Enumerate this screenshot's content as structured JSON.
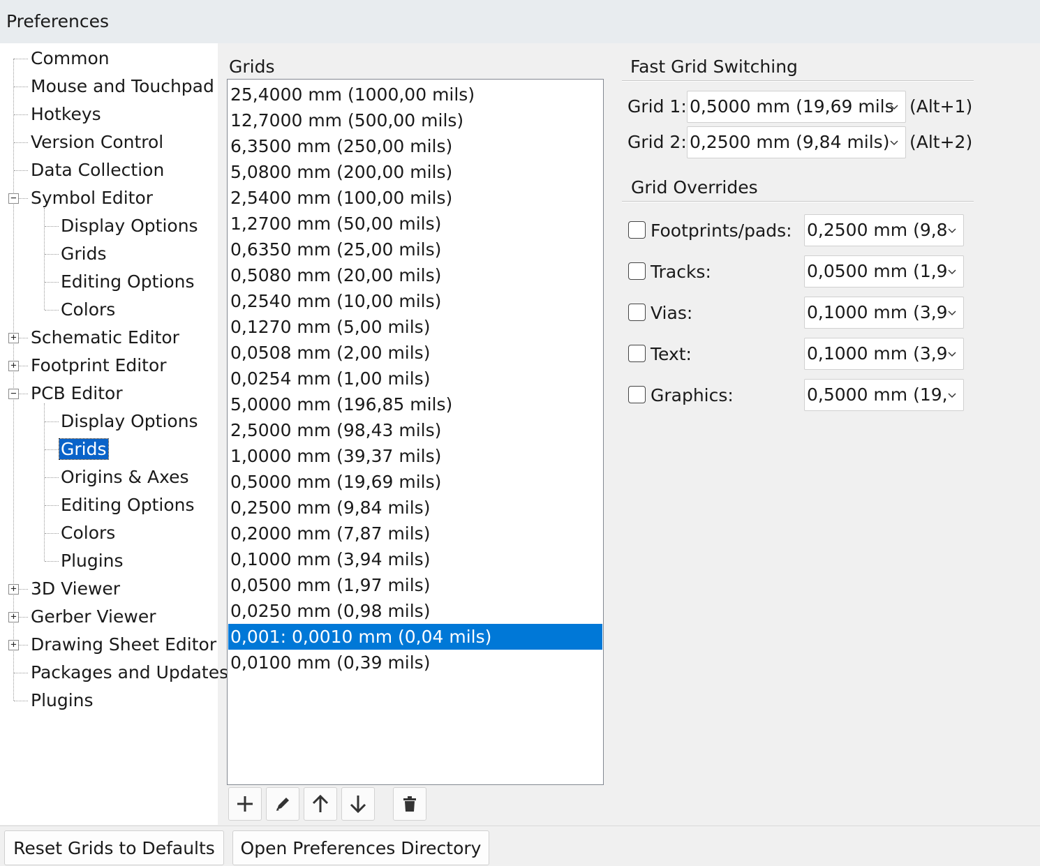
{
  "window": {
    "title": "Preferences"
  },
  "tree": {
    "items": [
      {
        "label": "Common"
      },
      {
        "label": "Mouse and Touchpad"
      },
      {
        "label": "Hotkeys"
      },
      {
        "label": "Version Control"
      },
      {
        "label": "Data Collection"
      },
      {
        "label": "Symbol Editor",
        "expander": "−"
      },
      {
        "label": "Display Options"
      },
      {
        "label": "Grids"
      },
      {
        "label": "Editing Options"
      },
      {
        "label": "Colors"
      },
      {
        "label": "Schematic Editor",
        "expander": "+"
      },
      {
        "label": "Footprint Editor",
        "expander": "+"
      },
      {
        "label": "PCB Editor",
        "expander": "−"
      },
      {
        "label": "Display Options"
      },
      {
        "label": "Grids",
        "selected": true
      },
      {
        "label": "Origins & Axes"
      },
      {
        "label": "Editing Options"
      },
      {
        "label": "Colors"
      },
      {
        "label": "Plugins"
      },
      {
        "label": "3D Viewer",
        "expander": "+"
      },
      {
        "label": "Gerber Viewer",
        "expander": "+"
      },
      {
        "label": "Drawing Sheet Editor",
        "expander": "+"
      },
      {
        "label": "Packages and Updates"
      },
      {
        "label": "Plugins"
      }
    ]
  },
  "grids": {
    "label": "Grids",
    "items": [
      "25,4000 mm (1000,00 mils)",
      "12,7000 mm (500,00 mils)",
      "6,3500 mm (250,00 mils)",
      "5,0800 mm (200,00 mils)",
      "2,5400 mm (100,00 mils)",
      "1,2700 mm (50,00 mils)",
      "0,6350 mm (25,00 mils)",
      "0,5080 mm (20,00 mils)",
      "0,2540 mm (10,00 mils)",
      "0,1270 mm (5,00 mils)",
      "0,0508 mm (2,00 mils)",
      "0,0254 mm (1,00 mils)",
      "5,0000 mm (196,85 mils)",
      "2,5000 mm (98,43 mils)",
      "1,0000 mm (39,37 mils)",
      "0,5000 mm (19,69 mils)",
      "0,2500 mm (9,84 mils)",
      "0,2000 mm (7,87 mils)",
      "0,1000 mm (3,94 mils)",
      "0,0500 mm (1,97 mils)",
      "0,0250 mm (0,98 mils)",
      "0,001: 0,0010 mm (0,04 mils)",
      "0,0100 mm (0,39 mils)"
    ],
    "selected_index": 21
  },
  "fast_grid": {
    "title": "Fast Grid Switching",
    "grid1_label": "Grid 1:",
    "grid1_value": "0,5000 mm (19,69 mils",
    "grid1_hotkey": "(Alt+1)",
    "grid2_label": "Grid 2:",
    "grid2_value": "0,2500 mm (9,84 mils)",
    "grid2_hotkey": "(Alt+2)"
  },
  "overrides": {
    "title": "Grid Overrides",
    "rows": [
      {
        "label": "Footprints/pads:",
        "value": "0,2500 mm (9,8",
        "checked": false
      },
      {
        "label": "Tracks:",
        "value": "0,0500 mm (1,9",
        "checked": false
      },
      {
        "label": "Vias:",
        "value": "0,1000 mm (3,9",
        "checked": false
      },
      {
        "label": "Text:",
        "value": "0,1000 mm (3,9",
        "checked": false
      },
      {
        "label": "Graphics:",
        "value": "0,5000 mm (19,",
        "checked": false
      }
    ]
  },
  "buttons": {
    "reset": "Reset Grids to Defaults",
    "open_dir": "Open Preferences Directory"
  },
  "colors": {
    "selection": "#0078d7",
    "tree_selection": "#0a63c9"
  }
}
